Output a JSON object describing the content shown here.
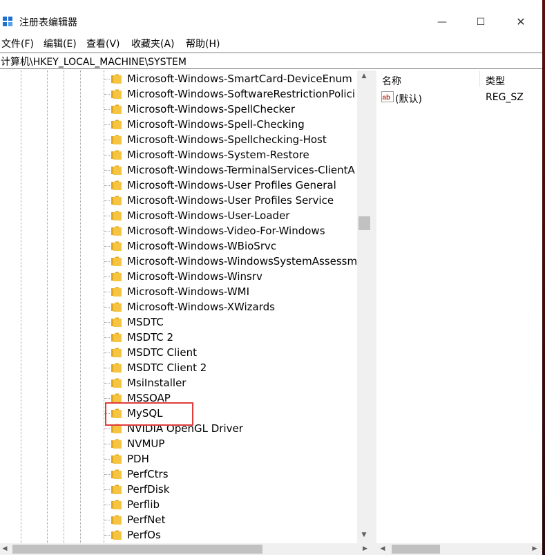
{
  "window": {
    "title": "注册表编辑器",
    "controls": {
      "minimize": "—",
      "maximize": "☐",
      "close": "✕"
    }
  },
  "menu": [
    "文件(F)",
    "编辑(E)",
    "查看(V)",
    "收藏夹(A)",
    "帮助(H)"
  ],
  "address": "计算机\\HKEY_LOCAL_MACHINE\\SYSTEM",
  "tree": {
    "items": [
      "Microsoft-Windows-SmartCard-DeviceEnum",
      "Microsoft-Windows-SoftwareRestrictionPolici",
      "Microsoft-Windows-SpellChecker",
      "Microsoft-Windows-Spell-Checking",
      "Microsoft-Windows-Spellchecking-Host",
      "Microsoft-Windows-System-Restore",
      "Microsoft-Windows-TerminalServices-ClientA",
      "Microsoft-Windows-User Profiles General",
      "Microsoft-Windows-User Profiles Service",
      "Microsoft-Windows-User-Loader",
      "Microsoft-Windows-Video-For-Windows",
      "Microsoft-Windows-WBioSrvc",
      "Microsoft-Windows-WindowsSystemAssessm",
      "Microsoft-Windows-Winsrv",
      "Microsoft-Windows-WMI",
      "Microsoft-Windows-XWizards",
      "MSDTC",
      "MSDTC 2",
      "MSDTC Client",
      "MSDTC Client 2",
      "MsiInstaller",
      "MSSOAP",
      "MySQL",
      "NVIDIA OpenGL Driver",
      "NVMUP",
      "PDH",
      "PerfCtrs",
      "PerfDisk",
      "Perflib",
      "PerfNet",
      "PerfOs"
    ],
    "highlighted_item": "MySQL"
  },
  "list": {
    "columns": {
      "name": "名称",
      "type": "类型"
    },
    "rows": [
      {
        "icon": "string-value-icon",
        "name": "(默认)",
        "type": "REG_SZ"
      }
    ]
  },
  "colors": {
    "highlight_border": "#e03c3c",
    "folder": "#f5c542"
  }
}
